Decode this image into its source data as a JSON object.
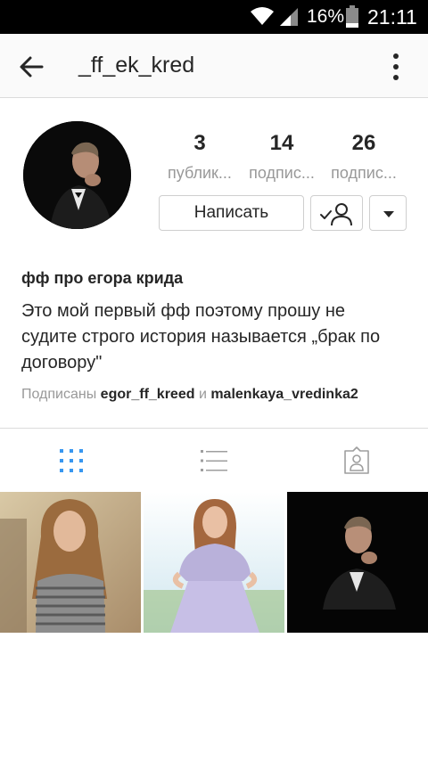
{
  "status_bar": {
    "battery_percent": "16%",
    "time": "21:11",
    "icons": [
      "wifi-icon",
      "signal-icon",
      "battery-icon"
    ]
  },
  "app_bar": {
    "title": "_ff_ek_kred",
    "back_icon": "arrow-left-icon",
    "more_icon": "more-vertical-icon"
  },
  "profile": {
    "stats": [
      {
        "count": "3",
        "label": "публик..."
      },
      {
        "count": "14",
        "label": "подпис..."
      },
      {
        "count": "26",
        "label": "подпис..."
      }
    ],
    "message_button": "Написать",
    "following_icon": "person-check-icon",
    "dropdown_icon": "triangle-down-icon"
  },
  "bio": {
    "name": "фф про егора крида",
    "text": "Это мой первый фф поэтому прошу не судите строго история называется „брак по договору\"",
    "followed_by_prefix": "Подписаны ",
    "followed_by_account1": "egor_ff_kreed",
    "followed_by_joiner": " и ",
    "followed_by_account2": "malenkaya_vredinka2"
  },
  "tabs": [
    {
      "icon": "grid-icon",
      "active": true
    },
    {
      "icon": "list-icon",
      "active": false
    },
    {
      "icon": "tagged-person-icon",
      "active": false
    }
  ],
  "colors": {
    "accent": "#3897f0",
    "inactive_icon": "#9e9e9e",
    "text": "#262626",
    "muted": "#999999",
    "border": "#dbdbdb"
  }
}
